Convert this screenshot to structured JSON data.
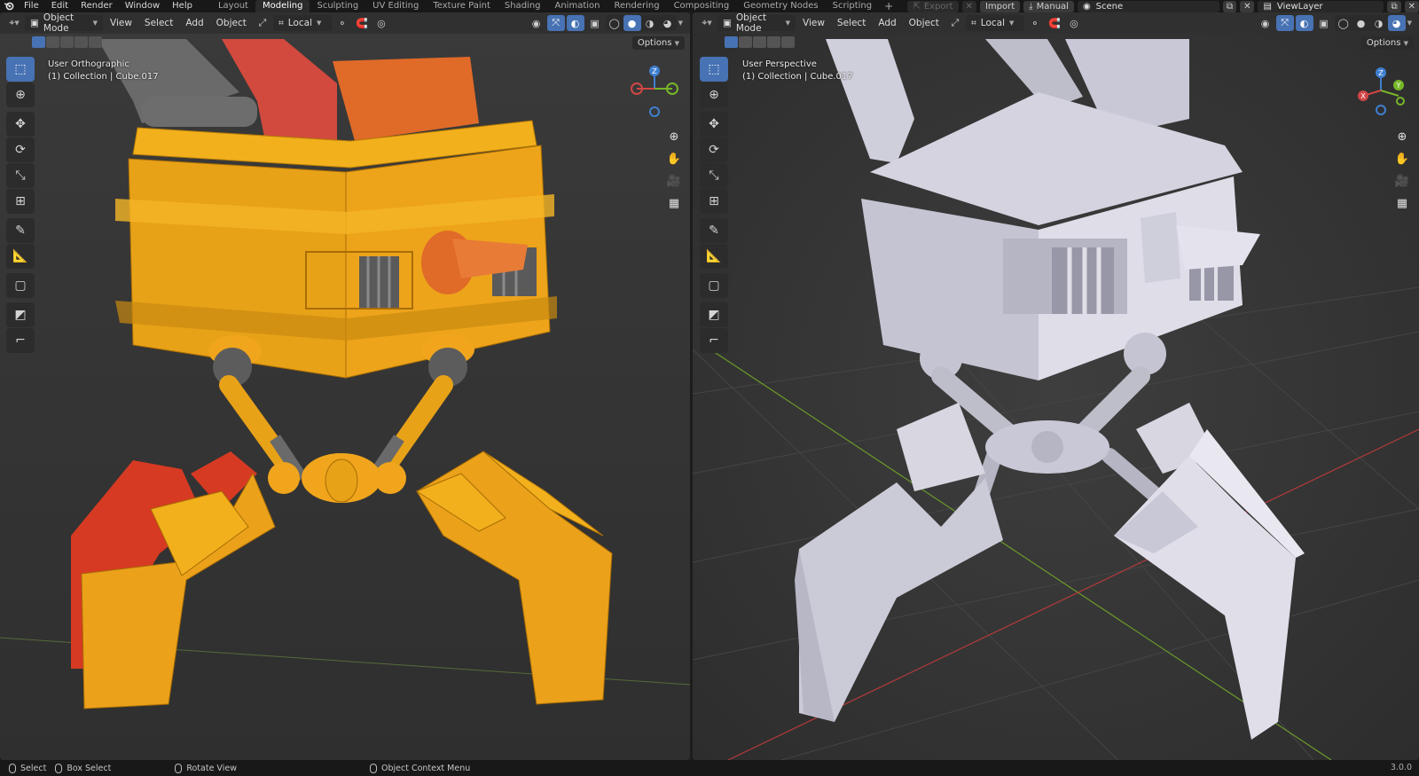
{
  "topbar": {
    "menus": [
      "File",
      "Edit",
      "Render",
      "Window",
      "Help"
    ],
    "workspaces": [
      "Layout",
      "Modeling",
      "Sculpting",
      "UV Editing",
      "Texture Paint",
      "Shading",
      "Animation",
      "Rendering",
      "Compositing",
      "Geometry Nodes",
      "Scripting"
    ],
    "active_workspace": "Modeling",
    "add_tab": "+",
    "right": {
      "export": "Export",
      "import": "Import",
      "manual": "Manual",
      "scene": "Scene",
      "view_layer": "ViewLayer"
    }
  },
  "viewports": {
    "left": {
      "mode": "Object Mode",
      "menus": [
        "View",
        "Select",
        "Add",
        "Object"
      ],
      "orientation": "Local",
      "options": "Options",
      "view_name": "User Orthographic",
      "collection": "(1) Collection | Cube.017",
      "shading_active": "solid"
    },
    "right": {
      "mode": "Object Mode",
      "menus": [
        "View",
        "Select",
        "Add",
        "Object"
      ],
      "orientation": "Local",
      "options": "Options",
      "view_name": "User Perspective",
      "collection": "(1) Collection | Cube.017",
      "shading_active": "rendered"
    }
  },
  "toolbar_icons": [
    "select-box-icon",
    "cursor-icon",
    "move-icon",
    "rotate-icon",
    "scale-icon",
    "transform-icon",
    "annotate-icon",
    "measure-icon",
    "add-cube-icon",
    "shade-icon",
    "edge-icon"
  ],
  "gizmo": {
    "z": "Z",
    "y": "Y",
    "x": "X"
  },
  "colors": {
    "accent": "#4772b3",
    "robot_orange": "#e8a218",
    "robot_red": "#d23a2a",
    "robot_clay": "#c8c7d8",
    "axis_x": "#d14646",
    "axis_y": "#77b628",
    "axis_z": "#3f7fd0"
  },
  "statusbar": {
    "select": "Select",
    "box_select": "Box Select",
    "rotate_view": "Rotate View",
    "context_menu": "Object Context Menu",
    "version": "3.0.0"
  }
}
